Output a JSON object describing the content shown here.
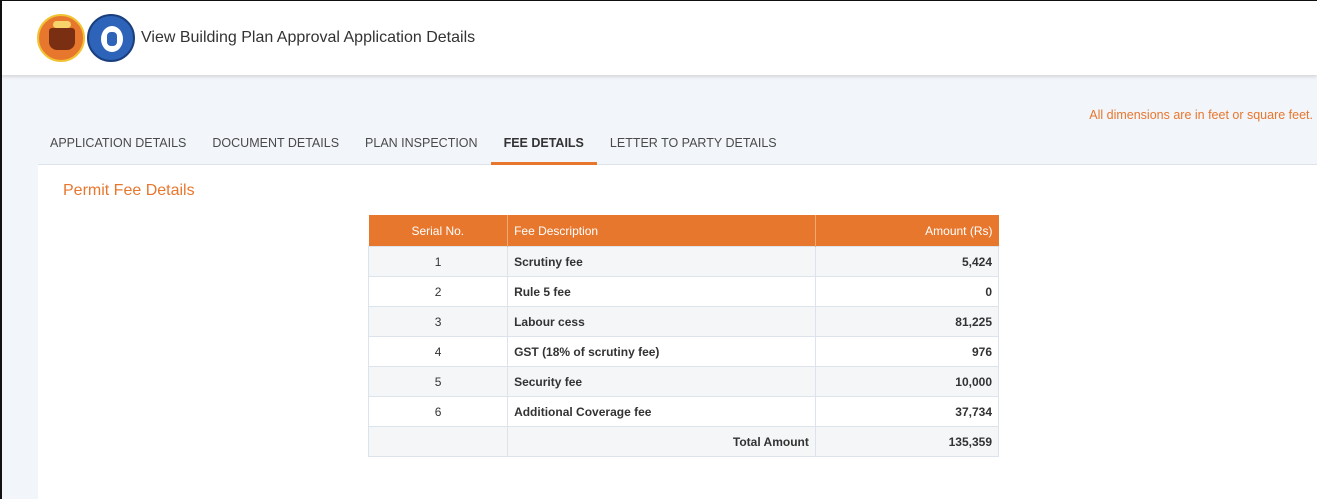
{
  "header": {
    "title": "View Building Plan Approval Application Details",
    "logos": [
      "state-emblem-icon",
      "municipal-corporation-logo-icon"
    ]
  },
  "note": "All dimensions are in feet or square feet.",
  "tabs": [
    {
      "label": "APPLICATION DETAILS",
      "active": false
    },
    {
      "label": "DOCUMENT DETAILS",
      "active": false
    },
    {
      "label": "PLAN INSPECTION",
      "active": false
    },
    {
      "label": "FEE DETAILS",
      "active": true
    },
    {
      "label": "LETTER TO PARTY DETAILS",
      "active": false
    }
  ],
  "panel": {
    "title": "Permit Fee Details"
  },
  "fee_table": {
    "headers": {
      "serial": "Serial No.",
      "description": "Fee Description",
      "amount": "Amount (Rs)"
    },
    "rows": [
      {
        "serial": "1",
        "description": "Scrutiny fee",
        "amount": "5,424"
      },
      {
        "serial": "2",
        "description": "Rule 5 fee",
        "amount": "0"
      },
      {
        "serial": "3",
        "description": "Labour cess",
        "amount": "81,225"
      },
      {
        "serial": "4",
        "description": "GST (18% of scrutiny fee)",
        "amount": "976"
      },
      {
        "serial": "5",
        "description": "Security fee",
        "amount": "10,000"
      },
      {
        "serial": "6",
        "description": "Additional Coverage fee",
        "amount": "37,734"
      }
    ],
    "total": {
      "label": "Total Amount",
      "amount": "135,359"
    }
  },
  "colors": {
    "accent": "#e8772e",
    "background": "#f2f5f9",
    "panel": "#ffffff"
  }
}
